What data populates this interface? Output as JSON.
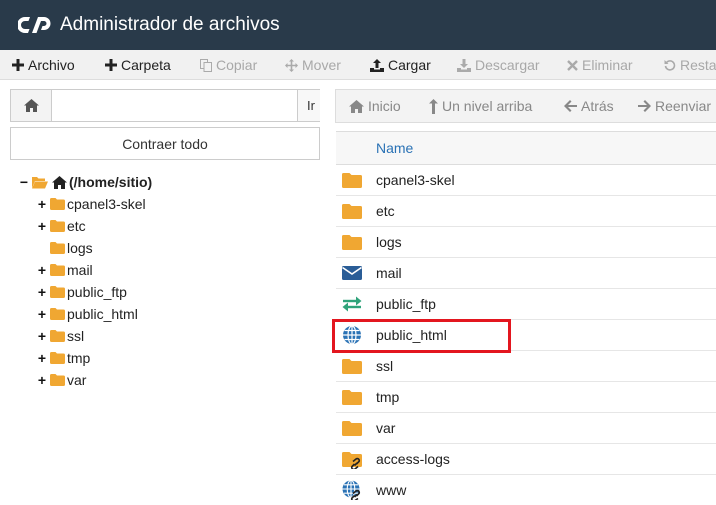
{
  "app": {
    "title": "Administrador de archivos",
    "logo_icon": "cpanel-logo-icon"
  },
  "toolbar": {
    "items": [
      {
        "label": "Archivo",
        "icon": "plus-icon",
        "enabled": true
      },
      {
        "label": "Carpeta",
        "icon": "plus-icon",
        "enabled": true
      },
      {
        "label": "Copiar",
        "icon": "copy-icon",
        "enabled": false
      },
      {
        "label": "Mover",
        "icon": "move-icon",
        "enabled": false
      },
      {
        "label": "Cargar",
        "icon": "upload-icon",
        "enabled": true
      },
      {
        "label": "Descargar",
        "icon": "download-icon",
        "enabled": false
      },
      {
        "label": "Eliminar",
        "icon": "times-icon",
        "enabled": false
      },
      {
        "label": "Resta",
        "icon": "restore-icon",
        "enabled": false
      }
    ]
  },
  "path_bar": {
    "value": "",
    "placeholder": "",
    "go_label": "Ir"
  },
  "collapse_label": "Contraer todo",
  "tree": {
    "root_label": "(/home/sitio)",
    "items": [
      {
        "label": "cpanel3-skel",
        "expandable": true
      },
      {
        "label": "etc",
        "expandable": true
      },
      {
        "label": "logs",
        "expandable": false
      },
      {
        "label": "mail",
        "expandable": true
      },
      {
        "label": "public_ftp",
        "expandable": true
      },
      {
        "label": "public_html",
        "expandable": true
      },
      {
        "label": "ssl",
        "expandable": true
      },
      {
        "label": "tmp",
        "expandable": true
      },
      {
        "label": "var",
        "expandable": true
      }
    ]
  },
  "nav": {
    "home": "Inicio",
    "up": "Un nivel arriba",
    "back": "Atrás",
    "forward": "Reenviar"
  },
  "files": {
    "column_name": "Name",
    "rows": [
      {
        "name": "cpanel3-skel",
        "icon": "folder-icon"
      },
      {
        "name": "etc",
        "icon": "folder-icon"
      },
      {
        "name": "logs",
        "icon": "folder-icon"
      },
      {
        "name": "mail",
        "icon": "envelope-icon"
      },
      {
        "name": "public_ftp",
        "icon": "transfer-icon"
      },
      {
        "name": "public_html",
        "icon": "globe-icon",
        "highlighted": true
      },
      {
        "name": "ssl",
        "icon": "folder-icon"
      },
      {
        "name": "tmp",
        "icon": "folder-icon"
      },
      {
        "name": "var",
        "icon": "folder-icon"
      },
      {
        "name": "access-logs",
        "icon": "folder-link-icon"
      },
      {
        "name": "www",
        "icon": "globe-link-icon"
      }
    ]
  },
  "colors": {
    "header_bg": "#293a4a",
    "folder": "#f0a732",
    "link_blue": "#2a72b5",
    "highlight": "#e3161f"
  }
}
